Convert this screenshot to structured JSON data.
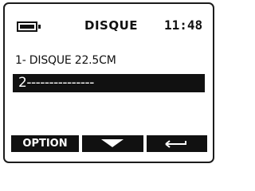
{
  "header": {
    "battery_icon": "battery-full-icon",
    "title": "DISQUE",
    "clock": "11:48"
  },
  "list": {
    "item1": "1- DISQUE 22.5CM",
    "item2": "2---------------"
  },
  "softkeys": {
    "option_label": "OPTION",
    "down_icon": "triangle-down-icon",
    "back_icon": "back-arrow-icon"
  },
  "colors": {
    "foreground": "#111111",
    "background": "#ffffff"
  }
}
